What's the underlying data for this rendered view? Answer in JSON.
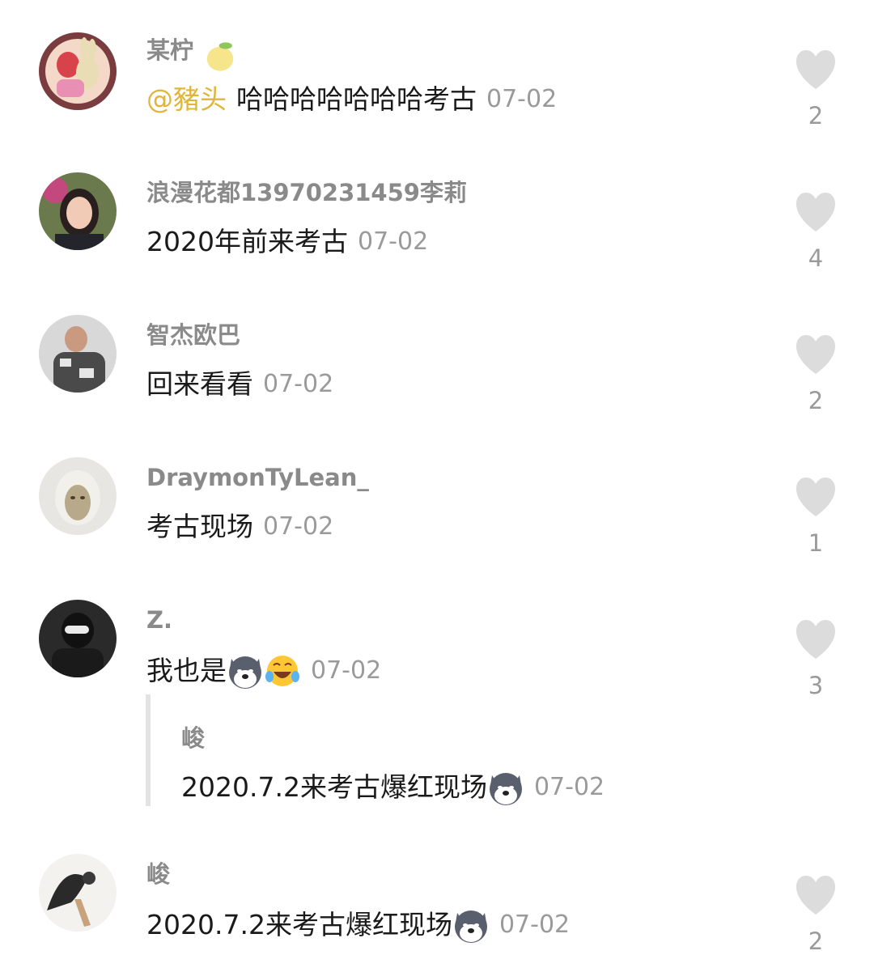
{
  "comments": [
    {
      "user": "某柠",
      "user_emoji": "lemon",
      "mention": "@豬头",
      "text": "哈哈哈哈哈哈哈考古",
      "date": "07-02",
      "likes": "2",
      "avatar": "cartoon-avatar"
    },
    {
      "user": "浪漫花都13970231459李莉",
      "text": "2020年前来考古",
      "date": "07-02",
      "likes": "4",
      "avatar": "woman-photo-avatar"
    },
    {
      "user": "智杰欧巴",
      "text": "回来看看",
      "date": "07-02",
      "likes": "2",
      "avatar": "man-photo-avatar"
    },
    {
      "user": "DraymonTyLean_",
      "text": "考古现场",
      "date": "07-02",
      "likes": "1",
      "avatar": "masked-photo-avatar"
    },
    {
      "user": "Z.",
      "text": "我也是",
      "emojis": [
        "doge",
        "laughing-crying"
      ],
      "date": "07-02",
      "likes": "3",
      "avatar": "dark-photo-avatar"
    },
    {
      "user": "峻",
      "text": "2020.7.2来考古爆红现场",
      "emojis": [
        "doge"
      ],
      "date": "07-02",
      "likes": "2",
      "avatar": "silhouette-avatar"
    }
  ],
  "reply": {
    "user": "峻",
    "text": "2020.7.2来考古爆红现场",
    "emojis": [
      "doge"
    ],
    "date": "07-02"
  },
  "colors": {
    "mention": "#e0b63a",
    "username": "#8a8a8a",
    "date": "#9a9a9a",
    "heart": "#dcdcdc"
  }
}
